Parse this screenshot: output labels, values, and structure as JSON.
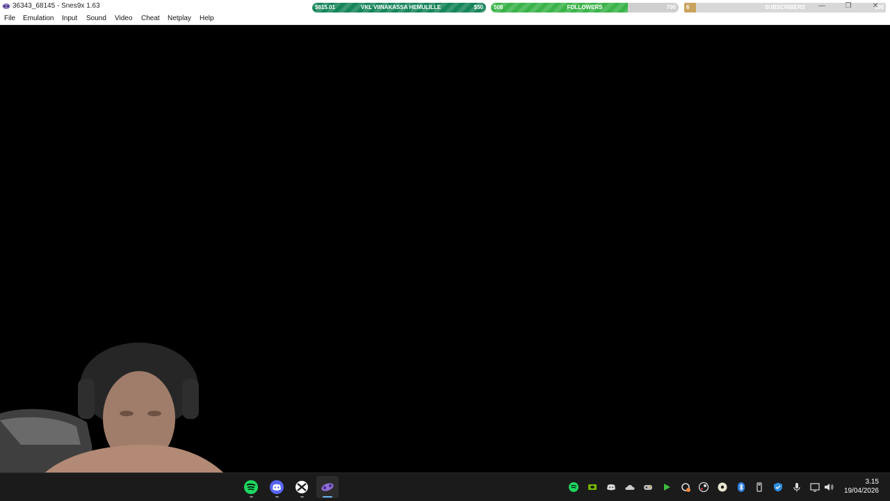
{
  "window": {
    "title": "36343_68145 - Snes9x 1.63",
    "controls": [
      "minimize-icon",
      "restore-icon",
      "close-icon"
    ]
  },
  "menu": [
    "File",
    "Emulation",
    "Input",
    "Sound",
    "Video",
    "Cheat",
    "Netplay",
    "Help"
  ],
  "overlays": {
    "goal": {
      "left_value": "$615.01",
      "label": "VKL VIINAKASSA HEMULILLE",
      "right_value": "$50",
      "progress": 1.0,
      "color": "#17855a"
    },
    "followers": {
      "current": "508",
      "label": "FOLLOWERS",
      "target": "700",
      "progress": 0.73,
      "color": "#3bb34a"
    },
    "subscribers": {
      "current": "6",
      "label": "SUBSCRIBERS",
      "target": "100",
      "progress": 0.06,
      "color": "#c9a35f"
    }
  },
  "taskbar": {
    "pinned": [
      "spotify-icon",
      "discord-icon",
      "xbox-icon",
      "snes9x-icon"
    ],
    "tray": [
      "spotify-icon",
      "nvidia-icon",
      "discord-icon",
      "onedrive-icon",
      "game-controller-icon",
      "play-icon",
      "sync-icon",
      "steam-icon",
      "obs-icon",
      "bluetooth-icon",
      "usb-drive-icon",
      "defender-icon",
      "microphone-icon",
      "display-icon",
      "speaker-icon"
    ],
    "time": "3.15",
    "date": "19/04/2026"
  }
}
